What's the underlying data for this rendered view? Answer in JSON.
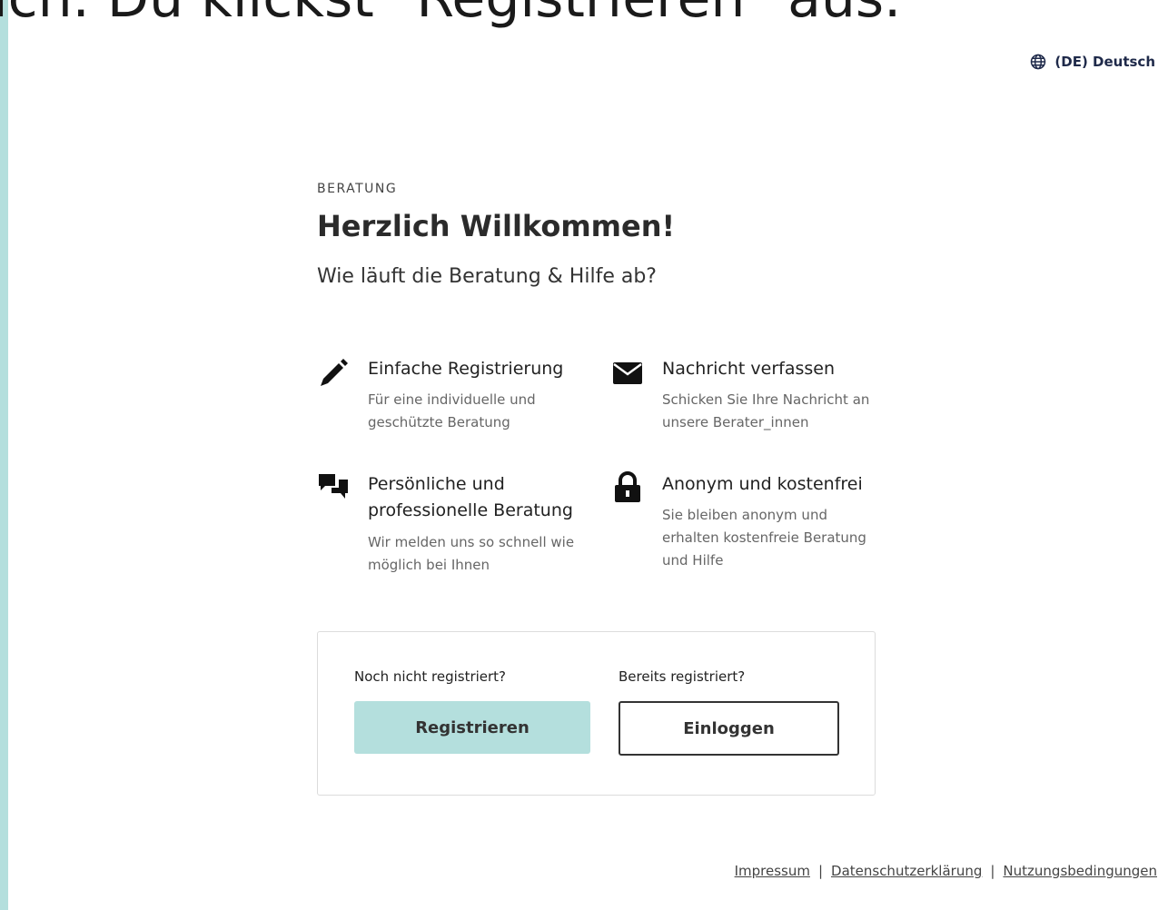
{
  "caption": {
    "text": "ich. Du klickst \"Registrieren\" aus."
  },
  "language": {
    "label": "(DE) Deutsch",
    "icon": "globe-icon"
  },
  "intro": {
    "eyebrow": "BERATUNG",
    "headline": "Herzlich Willkommen!",
    "subtitle": "Wie läuft die Beratung & Hilfe ab?"
  },
  "features": [
    {
      "icon": "pencil-icon",
      "title": "Einfache Registrierung",
      "desc": "Für eine individuelle und geschützte Beratung"
    },
    {
      "icon": "envelope-icon",
      "title": "Nachricht verfassen",
      "desc": "Schicken Sie Ihre Nachricht an unsere Berater_innen"
    },
    {
      "icon": "chat-bubbles-icon",
      "title": "Persönliche und professionelle Beratung",
      "desc": "Wir melden uns so schnell wie möglich bei Ihnen"
    },
    {
      "icon": "lock-icon",
      "title": "Anonym und kostenfrei",
      "desc": "Sie bleiben anonym und erhalten kostenfreie Beratung und Hilfe"
    }
  ],
  "cta": {
    "register_prompt": "Noch nicht registriert?",
    "register_label": "Registrieren",
    "login_prompt": "Bereits registriert?",
    "login_label": "Einloggen"
  },
  "footer": {
    "links": [
      "Impressum",
      "Datenschutzerklärung",
      "Nutzungsbedingungen"
    ],
    "separator": "|"
  },
  "colors": {
    "accent": "#b4dfdd",
    "navy": "#1f2a4a"
  }
}
